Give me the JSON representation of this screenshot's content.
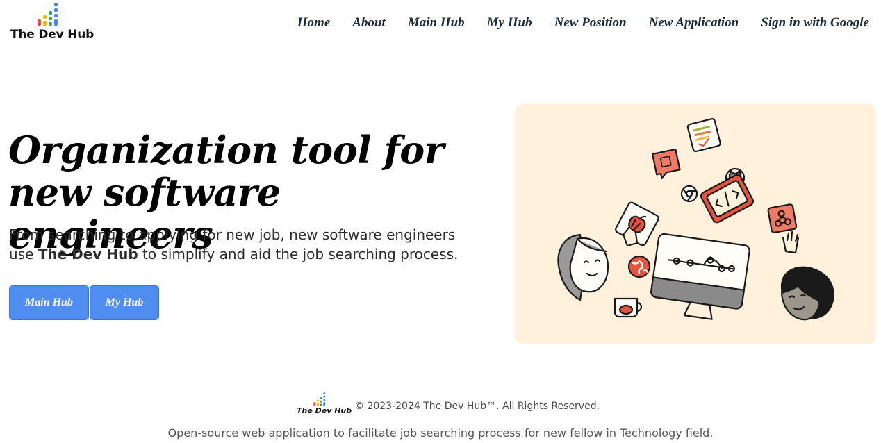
{
  "brand": {
    "name": "The Dev Hub",
    "colors": {
      "red": "#e94b3c",
      "yellow": "#f6b400",
      "green": "#34a853",
      "blue": "#4285f4"
    }
  },
  "nav": {
    "home": "Home",
    "about": "About",
    "main_hub": "Main Hub",
    "my_hub": "My Hub",
    "new_position": "New Position",
    "new_application": "New Application",
    "sign_in": "Sign in with Google"
  },
  "hero": {
    "title_line1": "Organization tool for",
    "title_line2": "new software engineers",
    "subtitle_before": "From searching to applying for new job, new software engineers use ",
    "subtitle_brand": "The Dev Hub",
    "subtitle_after": " to simplify and aid the job searching process.",
    "buttons": {
      "main_hub": "Main Hub",
      "my_hub": "My Hub"
    },
    "button_color": "#4f8ef0",
    "illustration_bg": "#fff1dc"
  },
  "footer": {
    "logo_text": "The Dev Hub",
    "copyright": "© 2023-2024 The Dev Hub™. All Rights Reserved.",
    "tagline": "Open-source web application to facilitate job searching process for new fellow in Technology field."
  }
}
